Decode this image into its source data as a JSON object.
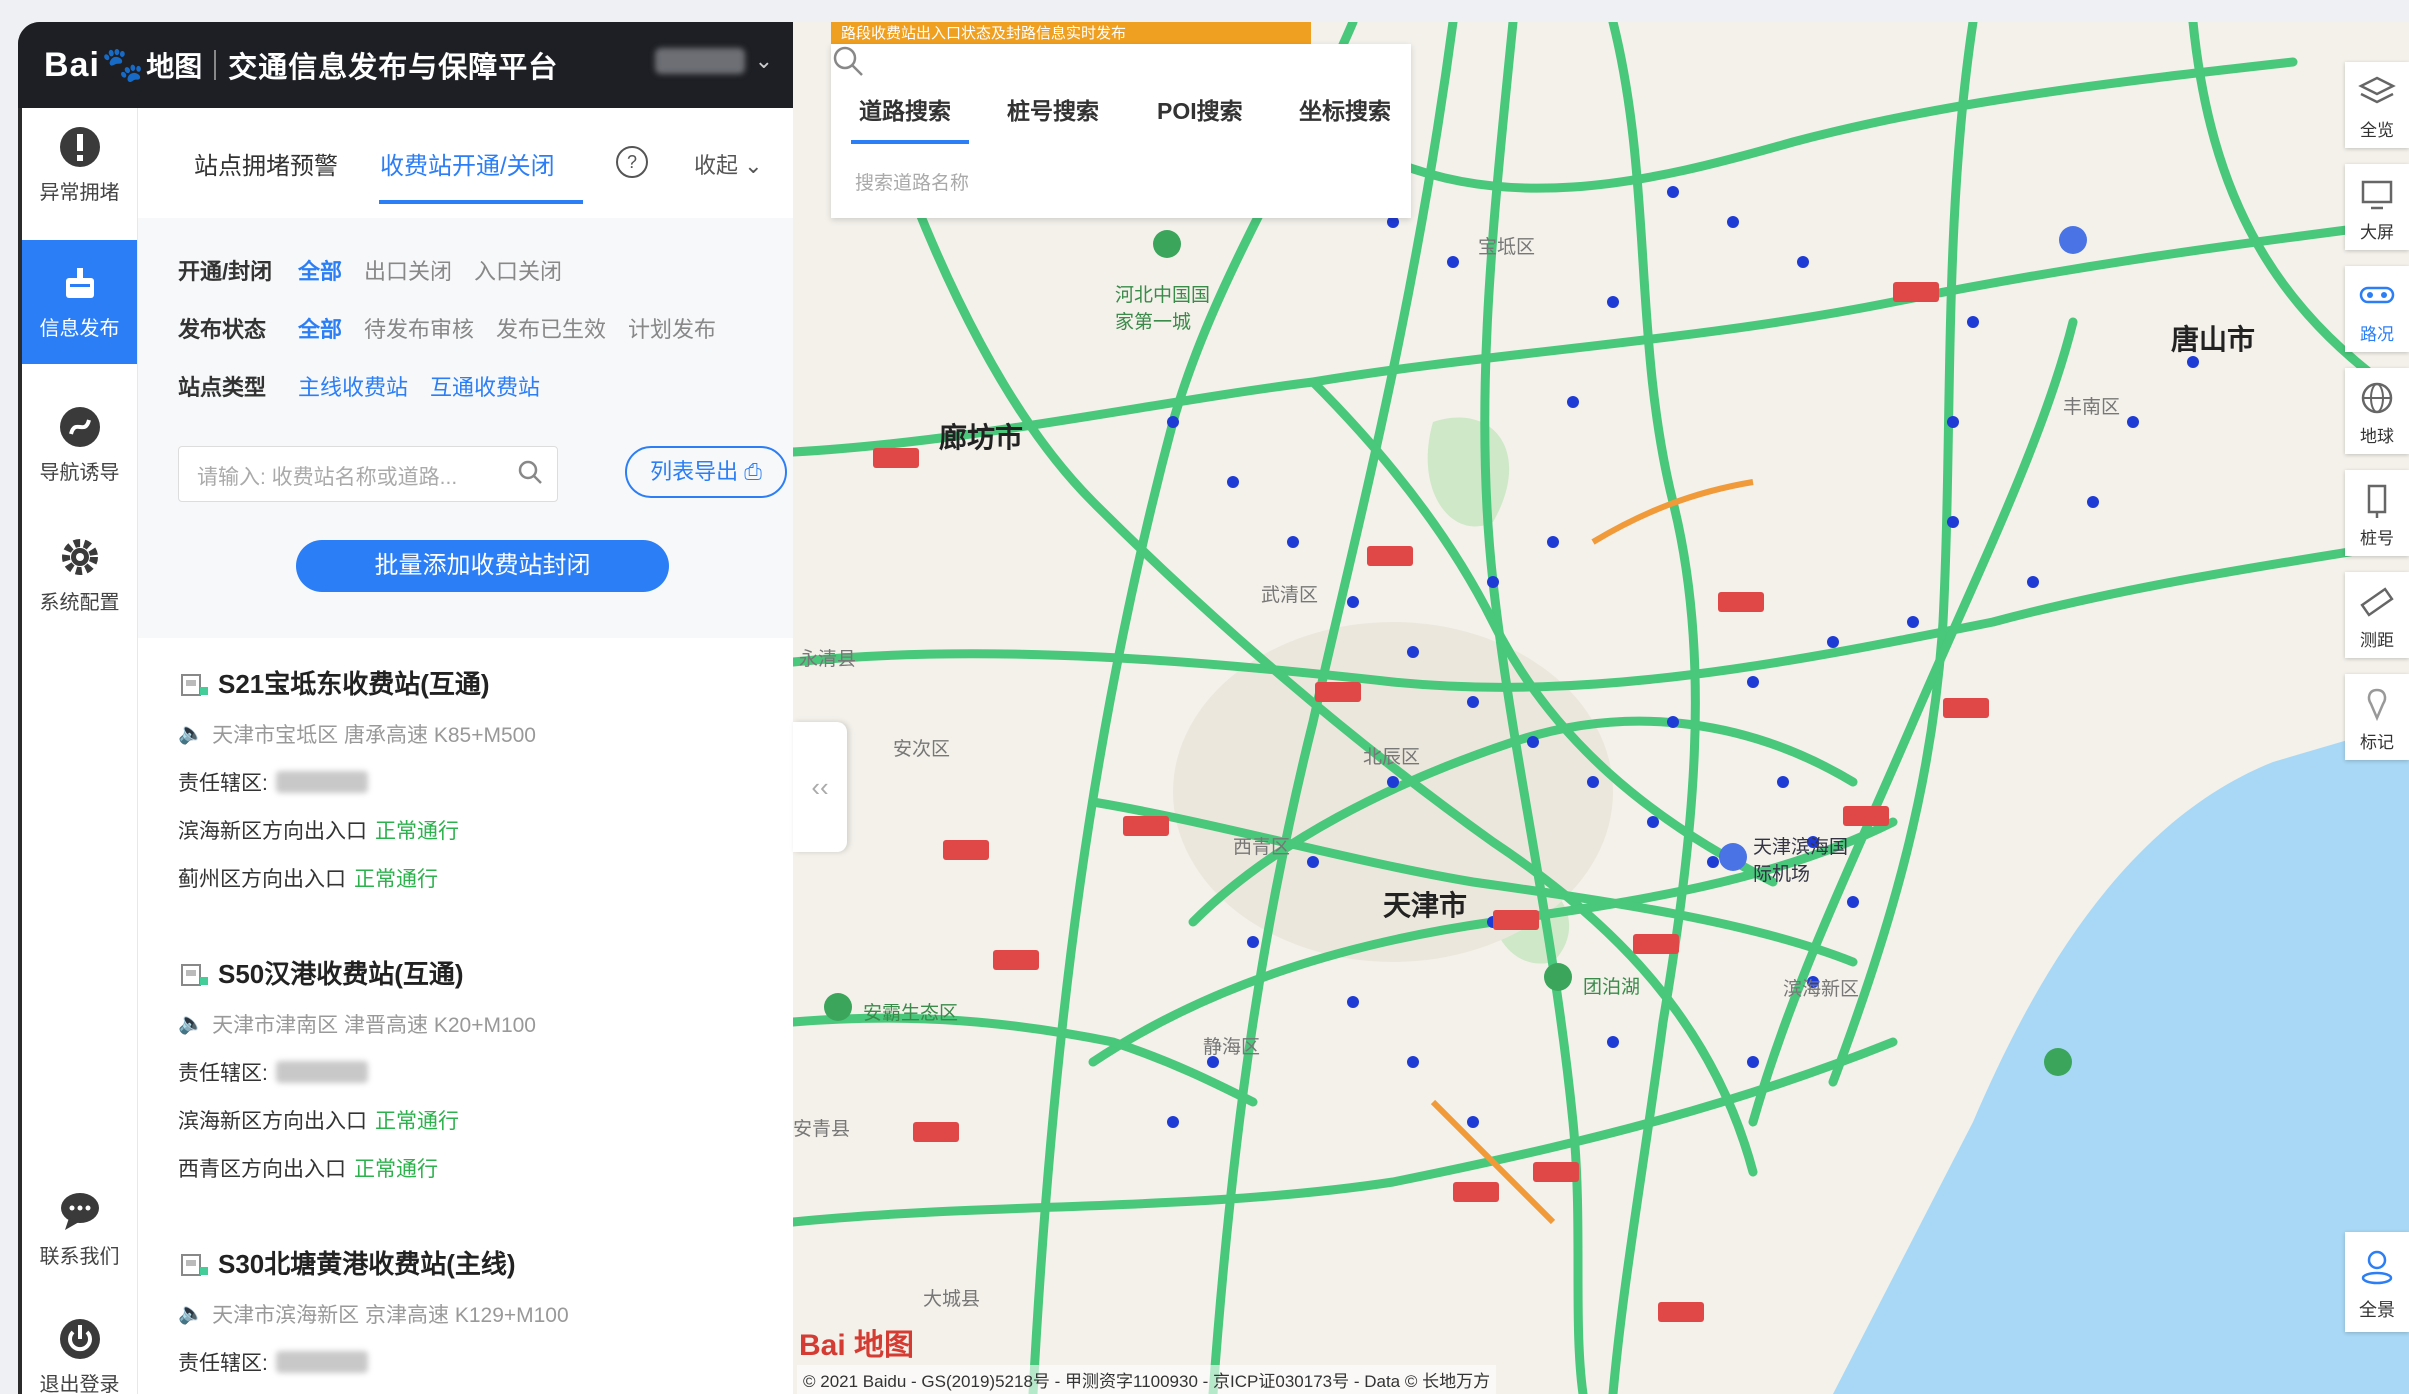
{
  "header": {
    "logo": "Bai",
    "logo_map": "地图",
    "title": "交通信息发布与保障平台"
  },
  "rail": [
    {
      "label": "异常拥堵",
      "icon": "alert-icon"
    },
    {
      "label": "信息发布",
      "icon": "publish-icon"
    },
    {
      "label": "导航诱导",
      "icon": "navigation-icon"
    },
    {
      "label": "系统配置",
      "icon": "gear-icon"
    },
    {
      "label": "联系我们",
      "icon": "chat-icon"
    },
    {
      "label": "退出登录",
      "icon": "power-icon"
    }
  ],
  "panel": {
    "tabs": [
      "站点拥堵预警",
      "收费站开通/关闭"
    ],
    "help": "?",
    "collapse": "收起",
    "filters": {
      "open_close": {
        "label": "开通/封闭",
        "options": [
          "全部",
          "出口关闭",
          "入口关闭"
        ]
      },
      "status": {
        "label": "发布状态",
        "options": [
          "全部",
          "待发布审核",
          "发布已生效",
          "计划发布"
        ]
      },
      "type": {
        "label": "站点类型",
        "options": [
          "主线收费站",
          "互通收费站"
        ]
      }
    },
    "search_placeholder": "请输入: 收费站名称或道路...",
    "export_label": "列表导出",
    "batch_label": "批量添加收费站封闭"
  },
  "stations": [
    {
      "name": "S21宝坻东收费站(互通)",
      "location": "天津市宝坻区 唐承高速 K85+M500",
      "resp_label": "责任辖区:",
      "dirs": [
        {
          "dir": "滨海新区方向出入口",
          "status": "正常通行"
        },
        {
          "dir": "蓟州区方向出入口",
          "status": "正常通行"
        }
      ]
    },
    {
      "name": "S50汉港收费站(互通)",
      "location": "天津市津南区 津晋高速 K20+M100",
      "resp_label": "责任辖区:",
      "dirs": [
        {
          "dir": "滨海新区方向出入口",
          "status": "正常通行"
        },
        {
          "dir": "西青区方向出入口",
          "status": "正常通行"
        }
      ]
    },
    {
      "name": "S30北塘黄港收费站(主线)",
      "location": "天津市滨海新区 京津高速 K129+M100",
      "resp_label": "责任辖区:",
      "dirs": []
    }
  ],
  "map": {
    "tabs": [
      "道路搜索",
      "桩号搜索",
      "POI搜索",
      "坐标搜索"
    ],
    "search_placeholder": "搜索道路名称",
    "banner": "路段收费站出入口状态及封路信息实时发布",
    "tools": [
      "全览",
      "大屏",
      "路况",
      "地球",
      "桩号",
      "测距",
      "标记"
    ],
    "panorama": "全景",
    "cities": [
      "廊坊市",
      "唐山市",
      "天津市"
    ],
    "towns": [
      "宝坻区",
      "武清区",
      "北辰区",
      "西青区",
      "滨海新区",
      "静海区",
      "永清县",
      "大城县",
      "安次区",
      "丰南区",
      "安青县",
      "河北中国国家第一城",
      "天津滨海国际机场",
      "团泊湖",
      "安霸生态区"
    ],
    "copyright": "© 2021 Baidu - GS(2019)5218号 - 甲测资字1100930 - 京ICP证030173号 - Data © 长地万方",
    "logo": "Bai 地图"
  },
  "colors": {
    "accent": "#2b7ef5",
    "header_bg": "#1d1f24",
    "road_green": "#49c77a",
    "sea": "#a8d8f5",
    "status_ok": "#2bb24c"
  }
}
